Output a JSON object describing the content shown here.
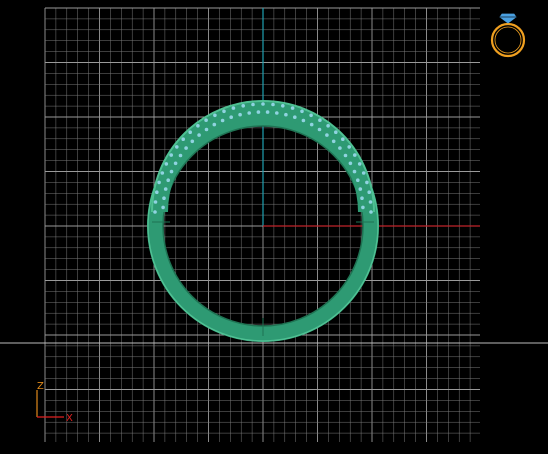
{
  "viewport": {
    "name": "front-view-3d-viewport",
    "background": "#000000",
    "grid_color": "#7a7a7a",
    "grid_major_color": "#9a9a9a",
    "horizon_color": "#bdbdbd"
  },
  "model": {
    "name": "pave-band-ring",
    "metal_color": "#2e9a73",
    "metal_highlight": "#4fc093",
    "metal_shadow": "#1f7353",
    "stone_color": "#8fd3e0"
  },
  "world_axes": {
    "x_color": "#c0242a",
    "y_color": "#1fa0b0"
  },
  "axis_indicator": {
    "z_label": "Z",
    "x_label": "X",
    "z_color": "#e08a1a",
    "x_color": "#e02020"
  },
  "view_cube": {
    "icon": "ring-icon",
    "ring_color": "#f0a020",
    "gem_color": "#4aa0e0"
  }
}
